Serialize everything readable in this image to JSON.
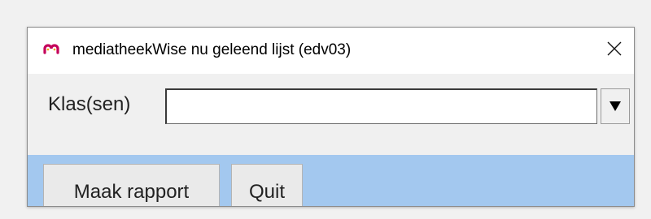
{
  "window": {
    "title": "mediatheekWise nu geleend lijst (edv03)",
    "icon": "mediatheekwise-logo-icon",
    "close_icon": "close-icon"
  },
  "form": {
    "klas_label": "Klas(sen)",
    "klas_value": "",
    "dropdown_icon": "triangle-down-icon"
  },
  "buttons": {
    "report_label": "Maak rapport",
    "quit_label": "Quit"
  },
  "colors": {
    "button_bar": "#a3c8ef",
    "logo": "#c4005a",
    "window_bg": "#f0f0f0"
  }
}
